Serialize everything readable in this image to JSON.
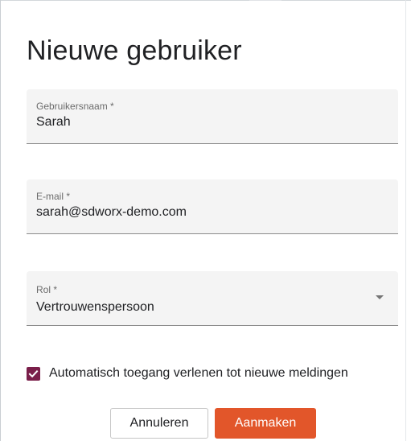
{
  "dialog": {
    "title": "Nieuwe gebruiker",
    "fields": {
      "username": {
        "label": "Gebruikersnaam *",
        "value": "Sarah"
      },
      "email": {
        "label": "E-mail *",
        "value": "sarah@sdworx-demo.com"
      },
      "role": {
        "label": "Rol *",
        "value": "Vertrouwenspersoon",
        "icon": "chevron-down-icon"
      }
    },
    "checkbox": {
      "label": "Automatisch toegang verlenen tot nieuwe meldingen",
      "checked": true,
      "color": "#7a1f4a"
    },
    "buttons": {
      "cancel_label": "Annuleren",
      "create_label": "Aanmaken",
      "create_color": "#e2562a"
    }
  }
}
